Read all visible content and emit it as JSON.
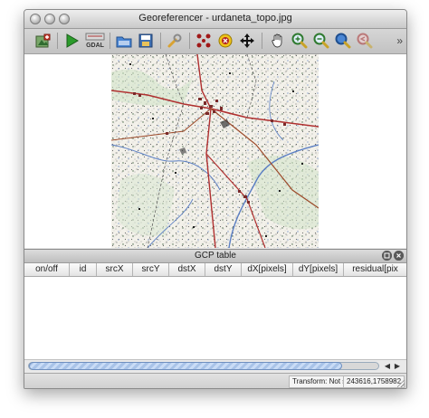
{
  "window": {
    "title": "Georeferencer - urdaneta_topo.jpg"
  },
  "toolbar": {
    "items": [
      {
        "name": "open-raster",
        "icon": "open-raster-icon"
      },
      {
        "name": "start-georeferencing",
        "icon": "play-icon"
      },
      {
        "name": "generate-gdal-script",
        "icon": "gdal-script-icon",
        "label": "GDAL"
      },
      {
        "name": "load-gcp-points",
        "icon": "load-gcp-icon"
      },
      {
        "name": "save-gcp-points",
        "icon": "save-gcp-icon"
      },
      {
        "name": "transformation-settings",
        "icon": "settings-wrench-icon"
      },
      {
        "name": "add-point",
        "icon": "add-point-icon"
      },
      {
        "name": "delete-point",
        "icon": "delete-point-icon"
      },
      {
        "name": "move-gcp-point",
        "icon": "move-point-icon"
      },
      {
        "name": "pan",
        "icon": "pan-hand-icon"
      },
      {
        "name": "zoom-in",
        "icon": "zoom-in-icon"
      },
      {
        "name": "zoom-out",
        "icon": "zoom-out-icon"
      },
      {
        "name": "zoom-to-layer",
        "icon": "zoom-to-layer-icon"
      },
      {
        "name": "zoom-last",
        "icon": "zoom-last-icon"
      }
    ],
    "overflow_label": "»"
  },
  "gcp_panel": {
    "title": "GCP table",
    "columns": [
      "on/off",
      "id",
      "srcX",
      "srcY",
      "dstX",
      "dstY",
      "dX[pixels]",
      "dY[pixels]",
      "residual[pix"
    ]
  },
  "status": {
    "transform": "Transform: Not set",
    "coordinates": "243616,1758982"
  },
  "colors": {
    "accent": "#6f8fbf",
    "map_red": "#b03030",
    "map_blue": "#5b7fc4",
    "map_green": "#3f8f3f"
  }
}
